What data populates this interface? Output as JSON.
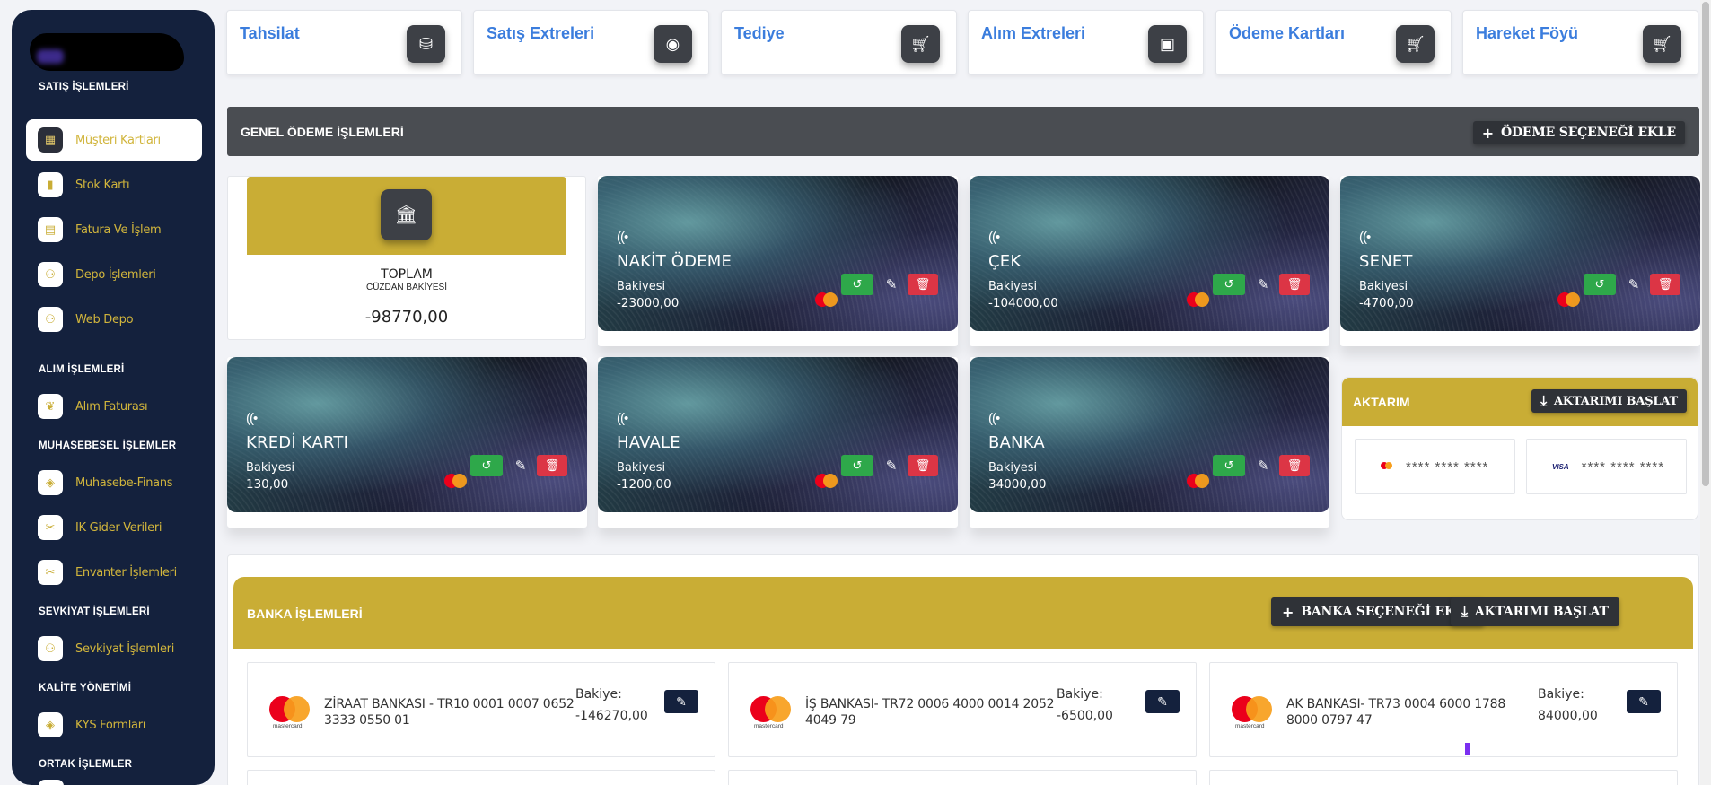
{
  "sidebar": {
    "sections": [
      {
        "label": "SATIŞ İŞLEMLERİ"
      },
      {
        "label": "ALIM İŞLEMLERİ"
      },
      {
        "label": "MUHASEBESEL İŞLEMLER"
      },
      {
        "label": "SEVKİYAT İŞLEMLERİ"
      },
      {
        "label": "KALİTE YÖNETİMİ"
      },
      {
        "label": "ORTAK İŞLEMLER"
      }
    ],
    "items": [
      {
        "label": "Müşteri Kartları",
        "icon": "store-icon",
        "active": true
      },
      {
        "label": "Stok Kartı",
        "icon": "chart-icon"
      },
      {
        "label": "Fatura Ve İşlem",
        "icon": "invoice-icon"
      },
      {
        "label": "Depo İşlemleri",
        "icon": "users-icon"
      },
      {
        "label": "Web Depo",
        "icon": "users-icon"
      },
      {
        "label": "Alım Faturası",
        "icon": "leaf-icon"
      },
      {
        "label": "Muhasebe-Finans",
        "icon": "box-icon"
      },
      {
        "label": "IK Gider Verileri",
        "icon": "tools-icon"
      },
      {
        "label": "Envanter İşlemleri",
        "icon": "tools-icon"
      },
      {
        "label": "Sevkiyat İşlemleri",
        "icon": "users-icon"
      },
      {
        "label": "KYS Formları",
        "icon": "box-icon"
      }
    ]
  },
  "top_cards": [
    {
      "title": "Tahsilat",
      "icon": "coins-icon"
    },
    {
      "title": "Satış Extreleri",
      "icon": "globe-icon"
    },
    {
      "title": "Tediye",
      "icon": "cart-icon"
    },
    {
      "title": "Alım Extreleri",
      "icon": "contact-icon"
    },
    {
      "title": "Ödeme Kartları",
      "icon": "cart-icon"
    },
    {
      "title": "Hareket Föyü",
      "icon": "cart-icon"
    }
  ],
  "genel_odeme": {
    "title": "GENEL ÖDEME İŞLEMLERİ",
    "add_button": "ÖDEME SEÇENEĞİ EKLE"
  },
  "total": {
    "label": "TOPLAM",
    "sub": "CÜZDAN BAKİYESİ",
    "value": "-98770,00"
  },
  "payment_cards": [
    {
      "name": "NAKİT ÖDEME",
      "balance_label": "Bakiyesi",
      "balance": "-23000,00"
    },
    {
      "name": "ÇEK",
      "balance_label": "Bakiyesi",
      "balance": "-104000,00"
    },
    {
      "name": "SENET",
      "balance_label": "Bakiyesi",
      "balance": "-4700,00"
    },
    {
      "name": "KREDİ KARTI",
      "balance_label": "Bakiyesi",
      "balance": "130,00"
    },
    {
      "name": "HAVALE",
      "balance_label": "Bakiyesi",
      "balance": "-1200,00"
    },
    {
      "name": "BANKA",
      "balance_label": "Bakiyesi",
      "balance": "34000,00"
    }
  ],
  "aktarim": {
    "title": "AKTARIM",
    "button": "AKTARIMI BAŞLAT",
    "cards": [
      {
        "brand": "mastercard",
        "masked": "****  ****  ****"
      },
      {
        "brand": "VISA",
        "masked": "****  ****  ****"
      }
    ]
  },
  "banka": {
    "title": "BANKA İŞLEMLERİ",
    "add_button": "BANKA SEÇENEĞİ EKLE",
    "transfer_button": "AKTARIMI BAŞLAT",
    "accounts": [
      {
        "name": "ZİRAAT BANKASI - TR10 0001 0007 0652 3333 0550 01",
        "balance_label": "Bakiye:",
        "balance": "-146270,00"
      },
      {
        "name": "İŞ BANKASI- TR72 0006 4000 0014 2052 4049 79",
        "balance_label": "Bakiye:",
        "balance": "-6500,00"
      },
      {
        "name": "AK BANKASI- TR73 0004 6000 1788 8000 0797 47",
        "balance_label": "Bakiye:",
        "balance": "84000,00"
      }
    ],
    "mastercard_text": "mastercard"
  },
  "colors": {
    "sidebar_bg": "#14213d",
    "gold": "#c9ad35",
    "dark_bar": "#4a4d52",
    "link_blue": "#3b7ddd",
    "green": "#2ea84a",
    "red": "#dc3545"
  }
}
